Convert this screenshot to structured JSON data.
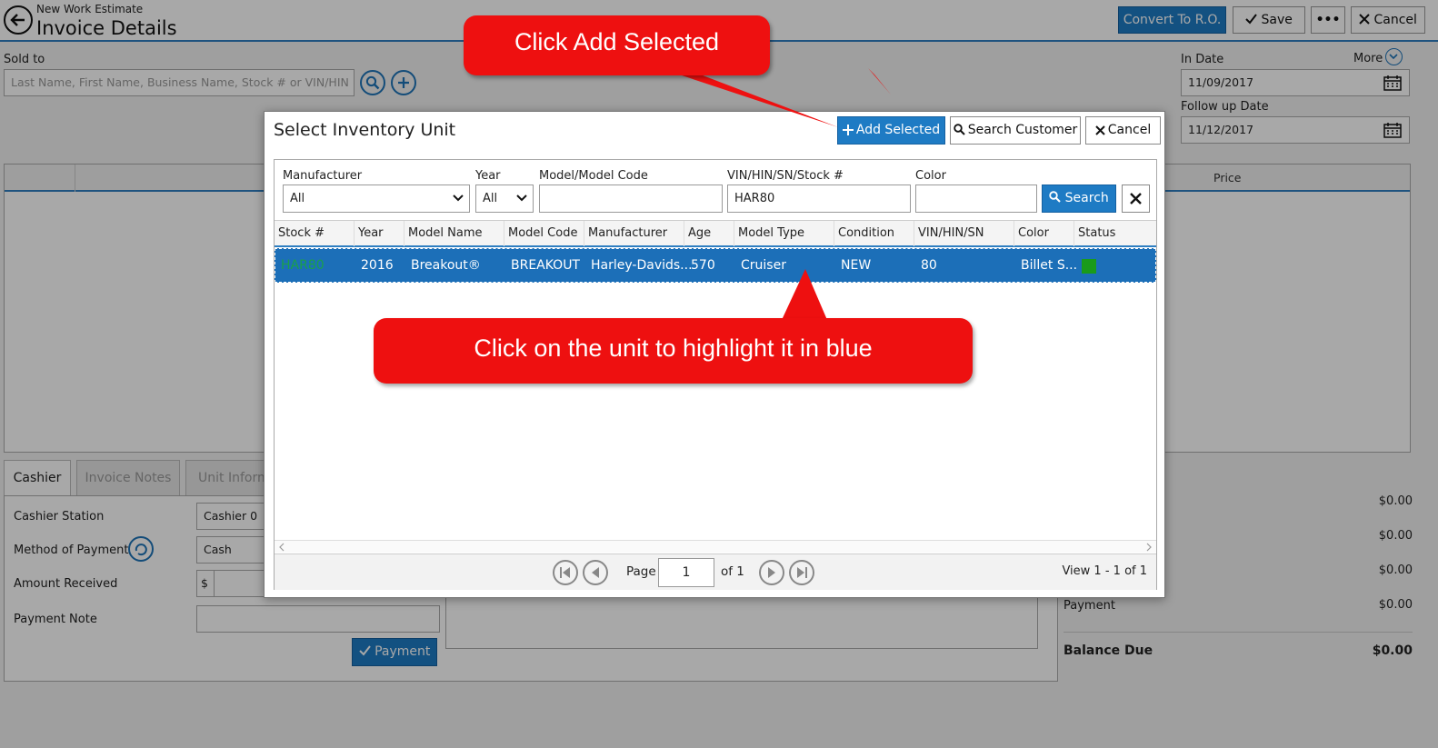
{
  "header": {
    "subtitle": "New Work Estimate",
    "title": "Invoice Details",
    "convert_label": "Convert To R.O.",
    "save_label": "Save",
    "more_label": "•••",
    "cancel_label": "Cancel"
  },
  "sold_to": {
    "label": "Sold to",
    "placeholder": "Last Name, First Name, Business Name, Stock # or VIN/HIN"
  },
  "dates": {
    "more_label": "More",
    "in_date_label": "In Date",
    "in_date_value": "11/09/2017",
    "follow_up_label": "Follow up Date",
    "follow_up_value": "11/12/2017"
  },
  "grid": {
    "price_header": "Price"
  },
  "tabs": [
    {
      "label": "Cashier"
    },
    {
      "label": "Invoice Notes"
    },
    {
      "label": "Unit Inform"
    }
  ],
  "cashier": {
    "station_label": "Cashier Station",
    "station_value": "Cashier 0",
    "method_label": "Method of Payment",
    "method_value": "Cash",
    "amount_label": "Amount Received",
    "currency_symbol": "$",
    "note_label": "Payment Note",
    "payment_button": "Payment"
  },
  "totals": {
    "amounts": [
      "$0.00",
      "$0.00",
      "$0.00",
      "$0.00"
    ],
    "payment_label": "Payment",
    "balance_label": "Balance Due",
    "balance_value": "$0.00"
  },
  "dialog": {
    "title": "Select Inventory Unit",
    "add_selected": "Add Selected",
    "search_customer": "Search Customer",
    "cancel": "Cancel",
    "filters": {
      "manufacturer_label": "Manufacturer",
      "manufacturer_value": "All",
      "year_label": "Year",
      "year_value": "All",
      "model_label": "Model/Model Code",
      "model_value": "",
      "vin_label": "VIN/HIN/SN/Stock #",
      "vin_value": "HAR80",
      "color_label": "Color",
      "color_value": "",
      "search_button": "Search"
    },
    "columns": [
      "Stock #",
      "Year",
      "Model Name",
      "Model Code",
      "Manufacturer",
      "Age",
      "Model Type",
      "Condition",
      "VIN/HIN/SN",
      "Color",
      "Status"
    ],
    "rows": [
      {
        "stock": "HAR80",
        "year": "2016",
        "model_name": "Breakout®",
        "model_code": "BREAKOUT",
        "manufacturer": "Harley-Davids...",
        "age": "570",
        "model_type": "Cruiser",
        "condition": "NEW",
        "vin": "80",
        "color": "Billet S...",
        "status_color": "#1a9b1a"
      }
    ],
    "pager": {
      "page_label": "Page",
      "page_value": "1",
      "of_label": "of 1",
      "view_label": "View 1 - 1 of 1"
    }
  },
  "callouts": {
    "add_selected": "Click Add Selected",
    "highlight": "Click on the unit to highlight it in blue"
  },
  "colors": {
    "accent": "#1e7bc4",
    "callout": "#ee1010",
    "selected_row": "#1c6fb8",
    "status_ok": "#1a9b1a"
  }
}
